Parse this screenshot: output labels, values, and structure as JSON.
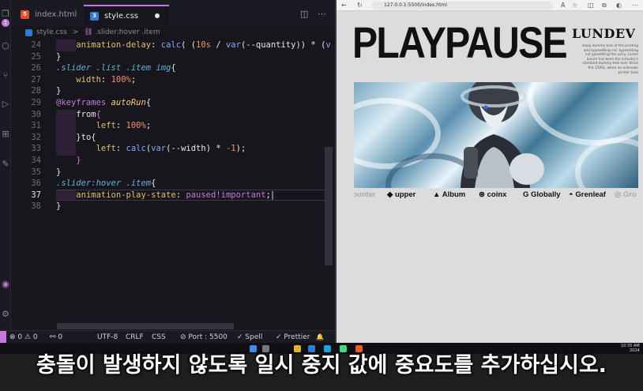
{
  "editor": {
    "tabs": [
      {
        "label": "index.html",
        "icon": "html5-icon"
      },
      {
        "label": "style.css",
        "icon": "css3-icon",
        "active": true,
        "unsaved": true
      }
    ],
    "breadcrumb": {
      "file": "style.css",
      "sep": ">",
      "symbol": ".slider:hover .item"
    },
    "activity_badge": "1",
    "lines": [
      {
        "num": "24",
        "tokens": [
          [
            "    ",
            "k-ctrl"
          ],
          [
            "animation-delay",
            "k-prop"
          ],
          [
            ": ",
            "k-ctrl"
          ],
          [
            "calc",
            "k-fn"
          ],
          [
            "( (",
            "k-ctrl"
          ],
          [
            "10s",
            "k-num"
          ],
          [
            " / ",
            "k-ctrl"
          ],
          [
            "var",
            "k-fn"
          ],
          [
            "(--quantity)) * (",
            "k-ctrl"
          ],
          [
            "v",
            "k-fn"
          ]
        ]
      },
      {
        "num": "25",
        "tokens": [
          [
            "}",
            "k-brace"
          ]
        ]
      },
      {
        "num": "26",
        "tokens": [
          [
            ".slider .list .item ",
            "k-sel"
          ],
          [
            "img",
            "k-sel"
          ],
          [
            "{",
            "k-brace"
          ]
        ]
      },
      {
        "num": "27",
        "tokens": [
          [
            "    ",
            "k-ctrl"
          ],
          [
            "width",
            "k-prop"
          ],
          [
            ": ",
            "k-ctrl"
          ],
          [
            "100%",
            "k-num"
          ],
          [
            ";",
            "k-ctrl"
          ]
        ]
      },
      {
        "num": "28",
        "tokens": [
          [
            "}",
            "k-brace"
          ]
        ]
      },
      {
        "num": "29",
        "tokens": [
          [
            "@keyframes ",
            "k-at"
          ],
          [
            "autoRun",
            "k-name"
          ],
          [
            "{",
            "k-brace"
          ]
        ]
      },
      {
        "num": "30",
        "tokens": [
          [
            "    ",
            "k-ctrl"
          ],
          [
            "from",
            "k-ctrl"
          ],
          [
            "{",
            "k-val"
          ]
        ]
      },
      {
        "num": "31",
        "tokens": [
          [
            "        ",
            "k-ctrl"
          ],
          [
            "left",
            "k-prop"
          ],
          [
            ": ",
            "k-ctrl"
          ],
          [
            "100%",
            "k-num"
          ],
          [
            ";",
            "k-ctrl"
          ]
        ]
      },
      {
        "num": "32",
        "tokens": [
          [
            "    ",
            "k-ctrl"
          ],
          [
            "}to{",
            "k-ctrl"
          ]
        ]
      },
      {
        "num": "33",
        "tokens": [
          [
            "        ",
            "k-ctrl"
          ],
          [
            "left",
            "k-prop"
          ],
          [
            ": ",
            "k-ctrl"
          ],
          [
            "calc",
            "k-fn"
          ],
          [
            "(",
            "k-ctrl"
          ],
          [
            "var",
            "k-fn"
          ],
          [
            "(--width) * ",
            "k-ctrl"
          ],
          [
            "-1",
            "k-num"
          ],
          [
            ");",
            "k-ctrl"
          ]
        ]
      },
      {
        "num": "34",
        "tokens": [
          [
            "    ",
            "k-ctrl"
          ],
          [
            "}",
            "k-val"
          ]
        ]
      },
      {
        "num": "35",
        "tokens": [
          [
            "}",
            "k-brace"
          ]
        ]
      },
      {
        "num": "36",
        "tokens": [
          [
            ".slider:hover .item",
            "k-sel"
          ],
          [
            "{",
            "k-brace"
          ]
        ]
      },
      {
        "num": "37",
        "tokens": [
          [
            "    ",
            "k-ctrl"
          ],
          [
            "animation-play-state",
            "k-prop"
          ],
          [
            ": ",
            "k-ctrl"
          ],
          [
            "paused",
            "k-val"
          ],
          [
            "!important",
            "k-val"
          ],
          [
            ";",
            "k-ctrl"
          ]
        ],
        "current": true
      },
      {
        "num": "38",
        "tokens": [
          [
            "}",
            "k-brace"
          ]
        ]
      }
    ],
    "status": {
      "errors": "⊗ 0 ⚠ 0",
      "ports": "⚯ 0",
      "encoding": "UTF-8",
      "eol": "CRLF",
      "language": "CSS",
      "live_server": "⊘ Port : 5500",
      "spell": "✓ Spell",
      "prettier": "✓ Prettier",
      "bell": "🔔"
    }
  },
  "browser": {
    "url": "127.0.0.1:5500/index.html",
    "site": {
      "title": "PLAYPAUSE",
      "brand": "LUNDEV",
      "description": "imply dummy text of the printing and typesetting ind. typesetting ind ypesetting the ustry. Lorem Ipsum has been the industry's standard dummy text ever Since the 1500s, when an unknown printer took"
    },
    "logos": [
      {
        "label": "ounter",
        "faded": true
      },
      {
        "label": "upper",
        "icon": "upper-logo-icon"
      },
      {
        "label": "Album",
        "icon": "album-logo-icon"
      },
      {
        "label": "coinx",
        "icon": "coinx-logo-icon"
      },
      {
        "label": "Globally",
        "icon": "globally-logo-icon"
      },
      {
        "label": "Grenleaf",
        "icon": "grenleaf-logo-icon"
      },
      {
        "label": "Gro",
        "icon": "gro-logo-icon",
        "faded": true
      }
    ]
  },
  "taskbar": {
    "time": "10:35 AM",
    "date": "2024"
  },
  "subtitle": "충돌이 발생하지 않도록 일시 중지 값에 중요도를 추가하십시오.",
  "colors": {
    "accent": "#c678dd",
    "editor_bg": "#16161c",
    "browser_bg": "#dcdcdc"
  }
}
